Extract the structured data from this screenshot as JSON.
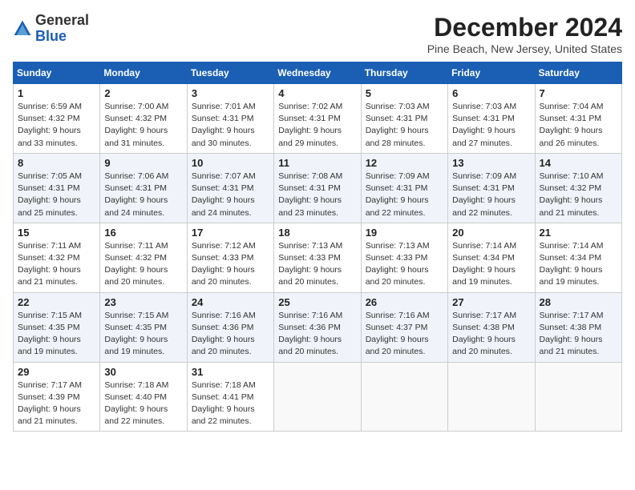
{
  "header": {
    "logo_general": "General",
    "logo_blue": "Blue",
    "month_title": "December 2024",
    "location": "Pine Beach, New Jersey, United States"
  },
  "days_of_week": [
    "Sunday",
    "Monday",
    "Tuesday",
    "Wednesday",
    "Thursday",
    "Friday",
    "Saturday"
  ],
  "weeks": [
    [
      {
        "day": "1",
        "sunrise": "6:59 AM",
        "sunset": "4:32 PM",
        "daylight": "9 hours and 33 minutes."
      },
      {
        "day": "2",
        "sunrise": "7:00 AM",
        "sunset": "4:32 PM",
        "daylight": "9 hours and 31 minutes."
      },
      {
        "day": "3",
        "sunrise": "7:01 AM",
        "sunset": "4:31 PM",
        "daylight": "9 hours and 30 minutes."
      },
      {
        "day": "4",
        "sunrise": "7:02 AM",
        "sunset": "4:31 PM",
        "daylight": "9 hours and 29 minutes."
      },
      {
        "day": "5",
        "sunrise": "7:03 AM",
        "sunset": "4:31 PM",
        "daylight": "9 hours and 28 minutes."
      },
      {
        "day": "6",
        "sunrise": "7:03 AM",
        "sunset": "4:31 PM",
        "daylight": "9 hours and 27 minutes."
      },
      {
        "day": "7",
        "sunrise": "7:04 AM",
        "sunset": "4:31 PM",
        "daylight": "9 hours and 26 minutes."
      }
    ],
    [
      {
        "day": "8",
        "sunrise": "7:05 AM",
        "sunset": "4:31 PM",
        "daylight": "9 hours and 25 minutes."
      },
      {
        "day": "9",
        "sunrise": "7:06 AM",
        "sunset": "4:31 PM",
        "daylight": "9 hours and 24 minutes."
      },
      {
        "day": "10",
        "sunrise": "7:07 AM",
        "sunset": "4:31 PM",
        "daylight": "9 hours and 24 minutes."
      },
      {
        "day": "11",
        "sunrise": "7:08 AM",
        "sunset": "4:31 PM",
        "daylight": "9 hours and 23 minutes."
      },
      {
        "day": "12",
        "sunrise": "7:09 AM",
        "sunset": "4:31 PM",
        "daylight": "9 hours and 22 minutes."
      },
      {
        "day": "13",
        "sunrise": "7:09 AM",
        "sunset": "4:31 PM",
        "daylight": "9 hours and 22 minutes."
      },
      {
        "day": "14",
        "sunrise": "7:10 AM",
        "sunset": "4:32 PM",
        "daylight": "9 hours and 21 minutes."
      }
    ],
    [
      {
        "day": "15",
        "sunrise": "7:11 AM",
        "sunset": "4:32 PM",
        "daylight": "9 hours and 21 minutes."
      },
      {
        "day": "16",
        "sunrise": "7:11 AM",
        "sunset": "4:32 PM",
        "daylight": "9 hours and 20 minutes."
      },
      {
        "day": "17",
        "sunrise": "7:12 AM",
        "sunset": "4:33 PM",
        "daylight": "9 hours and 20 minutes."
      },
      {
        "day": "18",
        "sunrise": "7:13 AM",
        "sunset": "4:33 PM",
        "daylight": "9 hours and 20 minutes."
      },
      {
        "day": "19",
        "sunrise": "7:13 AM",
        "sunset": "4:33 PM",
        "daylight": "9 hours and 20 minutes."
      },
      {
        "day": "20",
        "sunrise": "7:14 AM",
        "sunset": "4:34 PM",
        "daylight": "9 hours and 19 minutes."
      },
      {
        "day": "21",
        "sunrise": "7:14 AM",
        "sunset": "4:34 PM",
        "daylight": "9 hours and 19 minutes."
      }
    ],
    [
      {
        "day": "22",
        "sunrise": "7:15 AM",
        "sunset": "4:35 PM",
        "daylight": "9 hours and 19 minutes."
      },
      {
        "day": "23",
        "sunrise": "7:15 AM",
        "sunset": "4:35 PM",
        "daylight": "9 hours and 19 minutes."
      },
      {
        "day": "24",
        "sunrise": "7:16 AM",
        "sunset": "4:36 PM",
        "daylight": "9 hours and 20 minutes."
      },
      {
        "day": "25",
        "sunrise": "7:16 AM",
        "sunset": "4:36 PM",
        "daylight": "9 hours and 20 minutes."
      },
      {
        "day": "26",
        "sunrise": "7:16 AM",
        "sunset": "4:37 PM",
        "daylight": "9 hours and 20 minutes."
      },
      {
        "day": "27",
        "sunrise": "7:17 AM",
        "sunset": "4:38 PM",
        "daylight": "9 hours and 20 minutes."
      },
      {
        "day": "28",
        "sunrise": "7:17 AM",
        "sunset": "4:38 PM",
        "daylight": "9 hours and 21 minutes."
      }
    ],
    [
      {
        "day": "29",
        "sunrise": "7:17 AM",
        "sunset": "4:39 PM",
        "daylight": "9 hours and 21 minutes."
      },
      {
        "day": "30",
        "sunrise": "7:18 AM",
        "sunset": "4:40 PM",
        "daylight": "9 hours and 22 minutes."
      },
      {
        "day": "31",
        "sunrise": "7:18 AM",
        "sunset": "4:41 PM",
        "daylight": "9 hours and 22 minutes."
      },
      null,
      null,
      null,
      null
    ]
  ]
}
